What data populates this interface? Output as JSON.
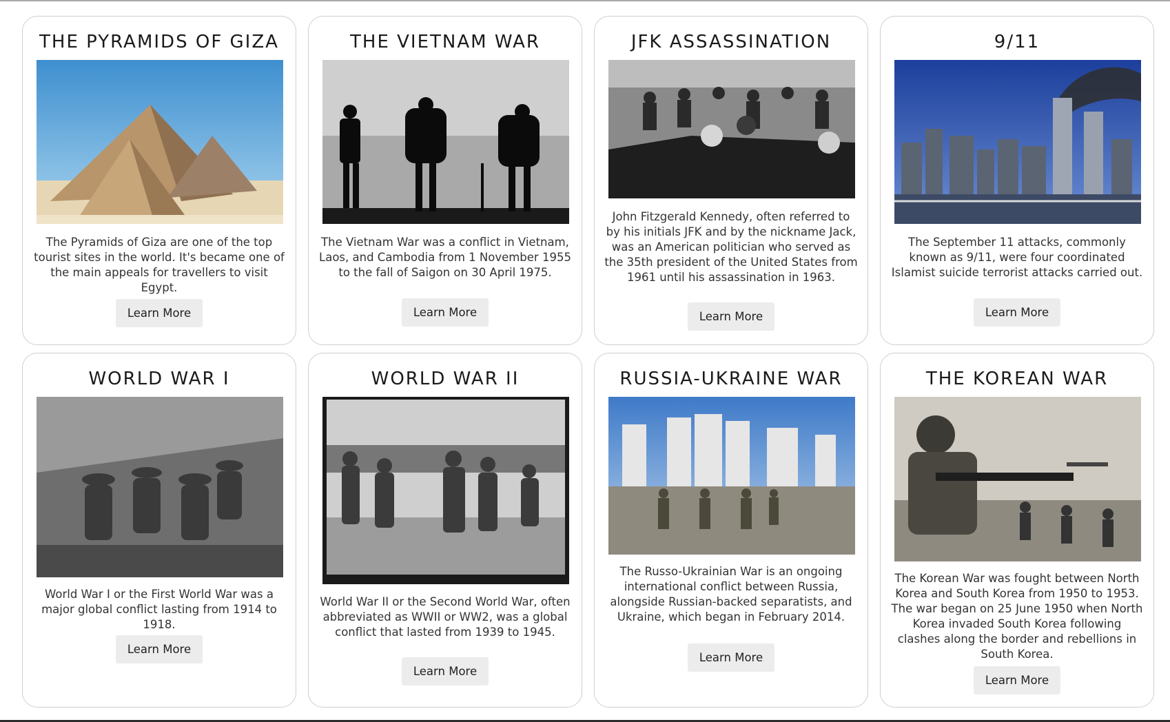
{
  "cards": [
    {
      "title": "THE PYRAMIDS OF GIZA",
      "image_label": "pyramids-photo",
      "description": "The Pyramids of Giza are one of the top tourist sites in the world. It's became one of the main appeals for travellers to visit Egypt.",
      "button": "Learn More"
    },
    {
      "title": "THE VIETNAM WAR",
      "image_label": "soldiers-silhouette-photo",
      "description": "The Vietnam War was a conflict in Vietnam, Laos, and Cambodia from 1 November 1955 to the fall of Saigon on 30 April 1975.",
      "button": "Learn More"
    },
    {
      "title": "JFK ASSASSINATION",
      "image_label": "motorcade-photo",
      "description": "John Fitzgerald Kennedy, often referred to by his initials JFK and by the nickname Jack, was an American politician who served as the 35th president of the United States from 1961 until his assassination in 1963.",
      "button": "Learn More"
    },
    {
      "title": "9/11",
      "image_label": "twin-towers-photo",
      "description": "The September 11 attacks, commonly known as 9/11, were four coordinated Islamist suicide terrorist attacks carried out.",
      "button": "Learn More"
    },
    {
      "title": "WORLD WAR I",
      "image_label": "trench-soldiers-photo",
      "description": "World War I or the First World War was a major global conflict lasting from 1914 to 1918.",
      "button": "Learn More"
    },
    {
      "title": "WORLD WAR II",
      "image_label": "landing-troops-photo",
      "description": "World War II or the Second World War, often abbreviated as WWII or WW2, was a global conflict that lasted from 1939 to 1945.",
      "button": "Learn More"
    },
    {
      "title": "RUSSIA-UKRAINE WAR",
      "image_label": "city-ruins-photo",
      "description": "The Russo-Ukrainian War is an ongoing international conflict between Russia, alongside Russian-backed separatists, and Ukraine, which began in February 2014.",
      "button": "Learn More"
    },
    {
      "title": "THE KOREAN WAR",
      "image_label": "korean-soldier-photo",
      "description": "The Korean War was fought between North Korea and South Korea from 1950 to 1953. The war began on 25 June 1950 when North Korea invaded South Korea following clashes along the border and rebellions in South Korea.",
      "button": "Learn More"
    }
  ]
}
